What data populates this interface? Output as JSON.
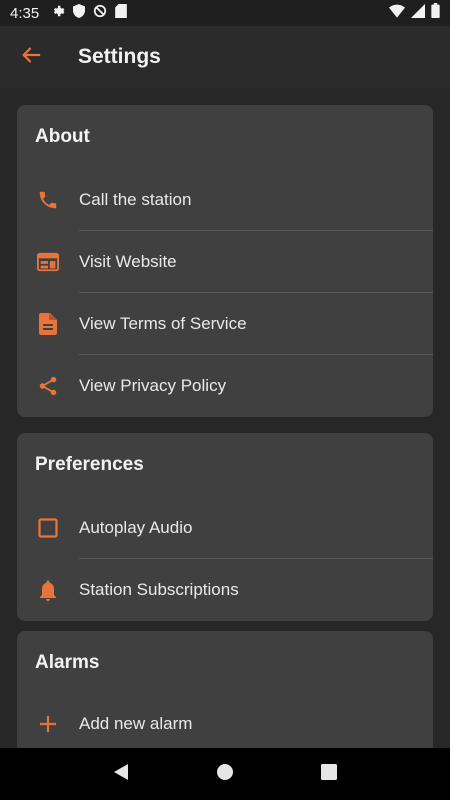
{
  "status_bar": {
    "time": "4:35"
  },
  "app_bar": {
    "title": "Settings"
  },
  "sections": {
    "about": {
      "title": "About",
      "items": [
        {
          "label": "Call the station",
          "icon": "phone-icon"
        },
        {
          "label": "Visit Website",
          "icon": "web-icon"
        },
        {
          "label": "View Terms of Service",
          "icon": "document-icon"
        },
        {
          "label": "View Privacy Policy",
          "icon": "share-icon"
        }
      ]
    },
    "preferences": {
      "title": "Preferences",
      "items": [
        {
          "label": "Autoplay Audio",
          "icon": "checkbox-icon",
          "checked": false
        },
        {
          "label": "Station Subscriptions",
          "icon": "bell-icon"
        }
      ]
    },
    "alarms": {
      "title": "Alarms",
      "items": [
        {
          "label": "Add new alarm",
          "icon": "plus-icon"
        }
      ]
    }
  },
  "colors": {
    "accent": "#e8743b",
    "card": "#404040",
    "background": "#272727"
  }
}
